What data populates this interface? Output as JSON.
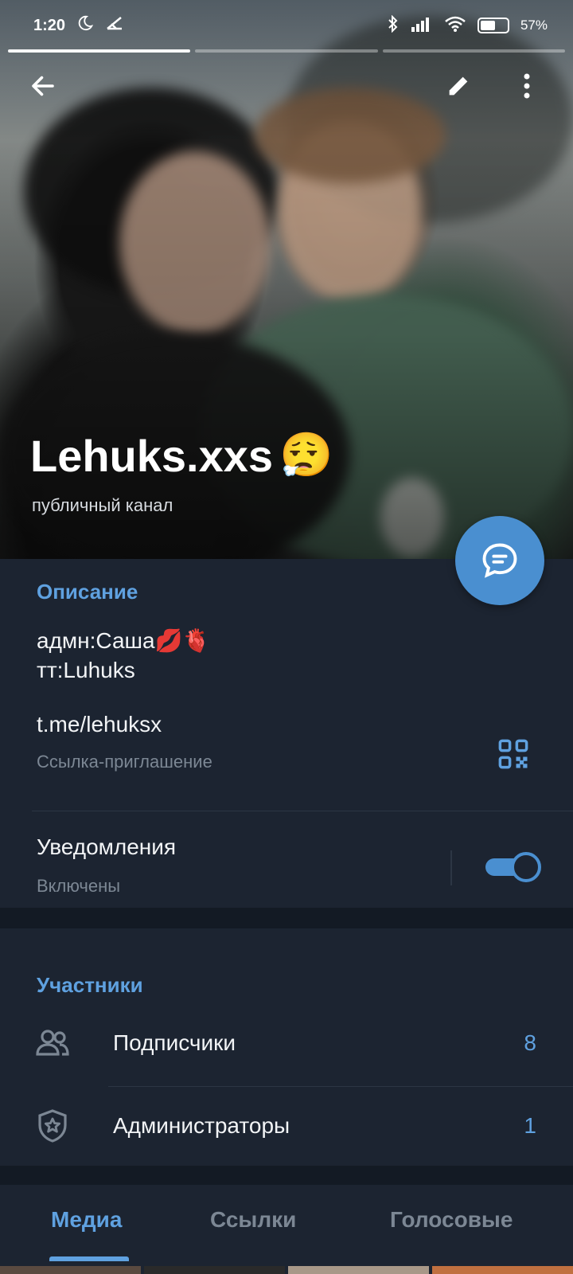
{
  "status_bar": {
    "time": "1:20",
    "battery": "57%",
    "battery_level": 0.57,
    "icons": [
      "moon-icon",
      "app-notification-icon",
      "bluetooth-icon",
      "signal-icon",
      "wifi-icon",
      "battery-icon"
    ]
  },
  "header": {
    "name": "Lehuks.xxs",
    "emoji": "😮‍💨",
    "subtitle": "публичный канал"
  },
  "info": {
    "description_title": "Описание",
    "description_line1": "адмн:Саша💋🫀",
    "description_line2": "тт:Luhuks",
    "link": "t.me/lehuksx",
    "link_caption": "Ссылка-приглашение",
    "notifications_label": "Уведомления",
    "notifications_status": "Включены",
    "notifications_on": true
  },
  "members": {
    "title": "Участники",
    "rows": [
      {
        "label": "Подписчики",
        "count": "8"
      },
      {
        "label": "Администраторы",
        "count": "1"
      }
    ]
  },
  "tabs": [
    {
      "label": "Медиа",
      "active": true
    },
    {
      "label": "Ссылки",
      "active": false
    },
    {
      "label": "Голосовые",
      "active": false
    }
  ],
  "colors": {
    "accent": "#5fa1e0",
    "background": "#1c2431",
    "fab": "#4a8fd0"
  }
}
